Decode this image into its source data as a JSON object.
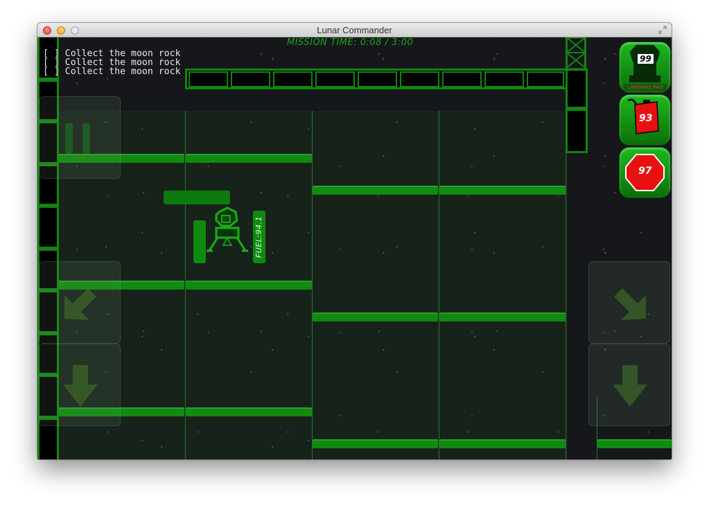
{
  "window": {
    "title": "Lunar Commander"
  },
  "hud": {
    "mission_time": "MISSION TIME: 0:08 / 3:00",
    "objectives": [
      {
        "checkbox": "[ ]",
        "text": "Collect the moon rock"
      },
      {
        "checkbox": "[ ]",
        "text": "Collect the moon rock"
      },
      {
        "checkbox": "[ ]",
        "text": "Collect the moon rock"
      }
    ],
    "badges": [
      {
        "icon": "landing-pad-icon",
        "value": "99",
        "label": "LANDING PAD"
      },
      {
        "icon": "fuel-canister-icon",
        "value": "93"
      },
      {
        "icon": "stop-sign-icon",
        "value": "97"
      }
    ]
  },
  "lander": {
    "fuel_text": "FUEL:94.1"
  },
  "controls": [
    {
      "icon": "pause-icon"
    },
    {
      "icon": "arrow-down-left-icon"
    },
    {
      "icon": "arrow-down-icon"
    },
    {
      "icon": "arrow-down-right-icon"
    },
    {
      "icon": "arrow-down-icon"
    }
  ],
  "colors": {
    "structure_green": "#128512",
    "platform_green": "#108a10",
    "hud_text_green": "#1ea51e",
    "badge_red": "#e81010",
    "space_background": "#15171a"
  }
}
